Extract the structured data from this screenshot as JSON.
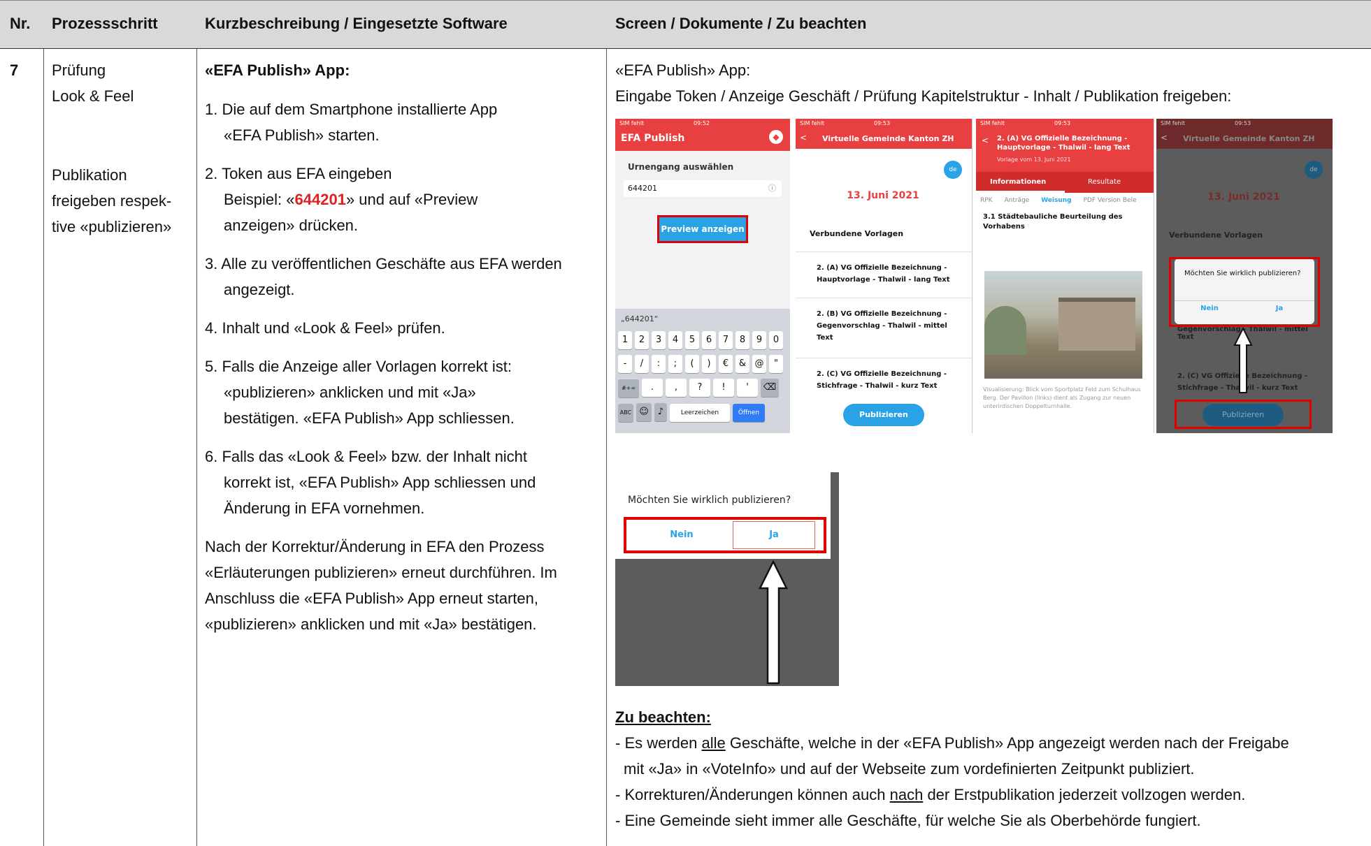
{
  "header": {
    "nr": "Nr.",
    "step": "Prozessschritt",
    "desc": "Kurzbeschreibung / Eingesetzte Software",
    "screen": "Screen / Dokumente / Zu beachten"
  },
  "row": {
    "nr": "7",
    "step_a1": "Prüfung",
    "step_a2": "Look & Feel",
    "step_b1": "Publikation",
    "step_b2": "freigeben respek-",
    "step_b3": "tive «publizieren»",
    "desc_title": "«EFA Publish» App:",
    "s1a": "1. Die auf dem Smartphone installierte App",
    "s1b": "«EFA Publish» starten.",
    "s2a": "2. Token aus EFA eingeben",
    "s2b_pre": "Beispiel: «",
    "s2b_token": "644201",
    "s2b_post": "» und auf «Preview",
    "s2c": "anzeigen» drücken.",
    "s3a": "3. Alle zu veröffentlichen Geschäfte aus EFA werden",
    "s3b": "angezeigt.",
    "s4": "4. Inhalt und «Look & Feel» prüfen.",
    "s5a": "5. Falls die Anzeige aller Vorlagen korrekt ist:",
    "s5b": "«publizieren» anklicken und mit «Ja»",
    "s5c": "bestätigen. «EFA Publish» App schliessen.",
    "s6a": "6. Falls das «Look & Feel» bzw. der Inhalt nicht",
    "s6b": "korrekt ist, «EFA Publish» App schliessen und",
    "s6c": "Änderung in EFA vornehmen.",
    "n1": "Nach der Korrektur/Änderung in EFA den Prozess",
    "n2": "«Erläuterungen publizieren» erneut durchführen. Im",
    "n3": "Anschluss die «EFA Publish» App erneut starten,",
    "n4": "«publizieren» anklicken und mit «Ja» bestätigen.",
    "scr1": "«EFA Publish» App:",
    "scr2": "Eingabe Token / Anzeige Geschäft / Prüfung Kapitelstruktur - Inhalt / Publikation freigeben:",
    "note_title": "Zu beachten:",
    "b1_pre": "- Es werden ",
    "b1_u": "alle",
    "b1_post": " Geschäfte, welche in der «EFA Publish» App angezeigt werden nach der Freigabe",
    "b1_cont": "mit «Ja» in «VoteInfo» und auf der Webseite zum vordefinierten Zeitpunkt publiziert.",
    "b2_pre": "- Korrekturen/Änderungen können auch ",
    "b2_u": "nach",
    "b2_post": " der Erstpublikation jederzeit vollzogen werden.",
    "b3": "- Eine Gemeinde sieht immer alle Geschäfte, für welche Sie als Oberbehörde fungiert."
  },
  "phone1": {
    "status_left": "SIM fehlt",
    "time": "09:52",
    "title": "EFA Publish",
    "label": "Urnengang auswählen",
    "input": "644201",
    "button": "Preview anzeigen",
    "suggest": "„644201“",
    "keys_row1": [
      "1",
      "2",
      "3",
      "4",
      "5",
      "6",
      "7",
      "8",
      "9",
      "0"
    ],
    "keys_row2": [
      "-",
      "/",
      ":",
      ";",
      "(",
      ")",
      "€",
      "&",
      "@",
      "\""
    ],
    "keys_row3": [
      "#+=",
      ".",
      ",",
      "?",
      "!",
      "'"
    ],
    "abc": "ABC",
    "space": "Leerzeichen",
    "open": "Öffnen"
  },
  "phone2": {
    "status_left": "SIM fehlt",
    "time": "09:53",
    "title": "Virtuelle Gemeinde Kanton ZH",
    "lang": "de",
    "date": "13. Juni 2021",
    "section": "Verbundene Vorlagen",
    "items": [
      "2. (A) VG Offizielle Bezeichnung - Hauptvorlage - Thalwil - lang Text",
      "2. (B) VG Offizielle Bezeichnung - Gegenvorschlag - Thalwil - mittel Text",
      "2. (C) VG Offizielle Bezeichnung - Stichfrage - Thalwil - kurz Text"
    ],
    "button": "Publizieren"
  },
  "phone3": {
    "status_left": "SIM fehlt",
    "time": "09:53",
    "title": "2. (A) VG Offizielle Bezeichnung - Hauptvorlage - Thalwil - lang Text",
    "subtitle": "Vorlage vom 13. Juni 2021",
    "tab1": "Informationen",
    "tab2": "Resultate",
    "subtabs": [
      "RPK",
      "Anträge",
      "Weisung",
      "PDF Version Bele"
    ],
    "heading": "3.1 Städtebauliche Beurteilung des Vorhabens",
    "caption": "Visualisierung: Blick vom Sportplatz Feld zum Schulhaus Berg. Der Pavillon (links) dient als Zugang zur neuen unterirdischen Doppelturnhalle."
  },
  "phone4": {
    "status_left": "SIM fehlt",
    "time": "09:53",
    "title": "Virtuelle Gemeinde Kanton ZH",
    "lang": "de",
    "date": "13. Juni 2021",
    "section": "Verbundene Vorlagen",
    "dialog": "Möchten Sie wirklich publizieren?",
    "no": "Nein",
    "yes": "Ja",
    "item_b": "Gegenvorschlag - Thalwil - mittel Text",
    "item_c": "2. (C) VG Offizielle Bezeichnung - Stichfrage - Thalwil - kurz Text",
    "button": "Publizieren"
  },
  "zoom": {
    "dialog": "Möchten Sie wirklich publizieren?",
    "no": "Nein",
    "yes": "Ja"
  }
}
